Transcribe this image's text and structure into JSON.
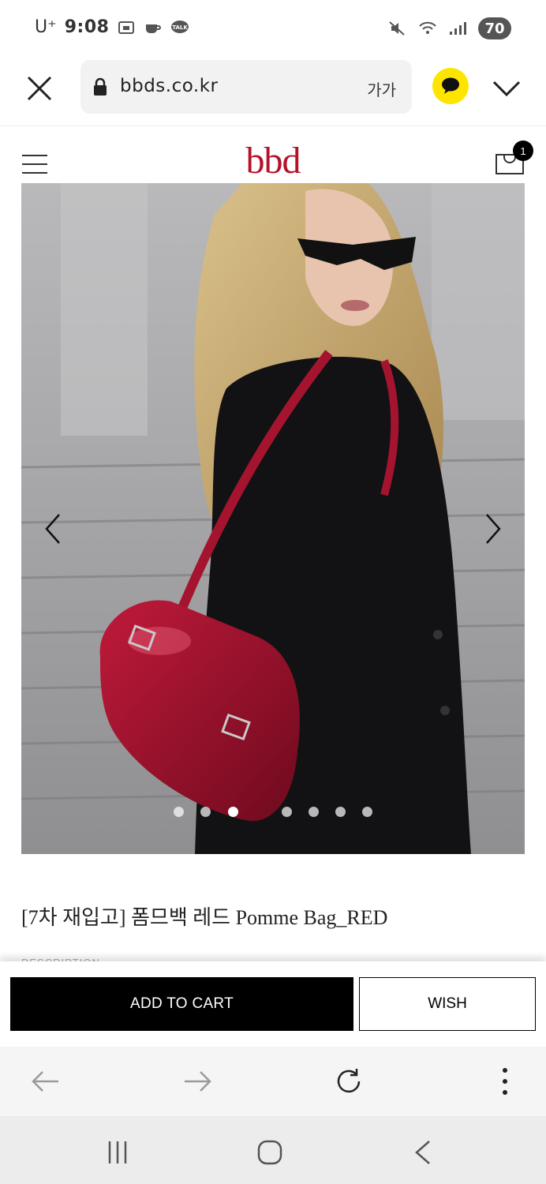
{
  "status_bar": {
    "carrier": "U⁺",
    "time": "9:08",
    "battery": "70"
  },
  "browser": {
    "url": "bbds.co.kr",
    "text_size_label": "가가"
  },
  "site": {
    "logo": "bbd",
    "cart_count": "1"
  },
  "carousel": {
    "slide_count": 7,
    "active_index": 2
  },
  "product": {
    "title": "[7차 재입고] 폼므백 레드 Pomme Bag_RED",
    "description_label": "DESCRIPTION"
  },
  "actions": {
    "add_to_cart": "ADD TO CART",
    "wish": "WISH"
  },
  "icons": {
    "close": "close-icon",
    "lock": "lock-icon",
    "kakao": "kakao-talk-icon",
    "chevron": "chevron-down-icon",
    "menu": "hamburger-menu-icon",
    "cart": "shopping-bag-icon",
    "prev": "chevron-left-icon",
    "next": "chevron-right-icon",
    "back": "arrow-left-icon",
    "forward": "arrow-right-icon",
    "refresh": "refresh-icon",
    "more": "more-vertical-icon"
  },
  "colors": {
    "brand": "#b5122a",
    "kakao": "#fee500"
  }
}
